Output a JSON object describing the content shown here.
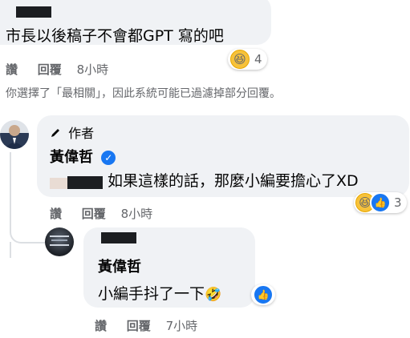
{
  "colors": {
    "accent": "#1877f2",
    "bubble": "#f0f2f5",
    "meta": "#65676b"
  },
  "comment1": {
    "text": "市長以後稿子不會都GPT 寫的吧",
    "like_label": "讚",
    "reply_label": "回覆",
    "time": "8小時",
    "reaction_icon": "haha-emoji-icon",
    "reaction_count": "4"
  },
  "notice": "你選擇了「最相關」，因此系統可能已過濾掉部分回覆。",
  "reply1": {
    "author_badge_icon": "pencil-icon",
    "author_badge": "作者",
    "author": "黃偉哲",
    "verified_icon": "verified-check-icon",
    "verified_glyph": "✓",
    "text": "如果這樣的話，那麼小編要擔心了XD",
    "like_label": "讚",
    "reply_label": "回覆",
    "time": "8小時",
    "reaction_count": "3"
  },
  "reply2": {
    "author": "黃偉哲",
    "text": "小編手抖了一下",
    "inline_emoji": "🤣",
    "like_label": "讚",
    "reply_label": "回覆",
    "time": "7小時"
  },
  "emoji": {
    "haha": "😆",
    "like": "👍"
  }
}
